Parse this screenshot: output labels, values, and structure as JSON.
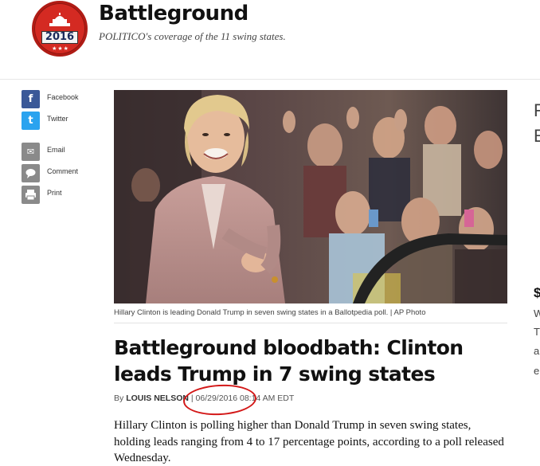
{
  "header": {
    "badge_year": "2016",
    "title": "Battleground",
    "subtitle": "POLITICO's coverage of the 11 swing states."
  },
  "share": {
    "items": [
      {
        "label": "Facebook",
        "icon": "facebook-icon",
        "glyph": "f",
        "color": "#3b5998"
      },
      {
        "label": "Twitter",
        "icon": "twitter-icon",
        "glyph": "t",
        "color": "#2aa3ef"
      },
      {
        "label": "Email",
        "icon": "email-icon",
        "glyph": "✉",
        "color": "#8a8a8a"
      },
      {
        "label": "Comment",
        "icon": "comment-icon",
        "glyph": "💬",
        "color": "#8a8a8a"
      },
      {
        "label": "Print",
        "icon": "print-icon",
        "glyph": "⎙",
        "color": "#8a8a8a"
      }
    ]
  },
  "article": {
    "photo_caption": "Hillary Clinton is leading Donald Trump in seven swing states in a Ballotpedia poll. | AP Photo",
    "headline": "Battleground bloodbath: Clinton leads Trump in 7 swing states",
    "byline_prefix": "By",
    "author": "Louis Nelson",
    "byline_sep": " | ",
    "date": "06/29/2016 08:14 AM EDT",
    "body": "Hillary Clinton is polling higher than Donald Trump in seven swing states, holding leads ranging from 4 to 17 percentage points, according to a poll released Wednesday."
  },
  "right_sliver": {
    "letters": [
      "F",
      "E",
      "$",
      "W",
      "T",
      "a",
      "e"
    ]
  },
  "colors": {
    "annotation_circle": "#d31818",
    "badge_red": "#d42a22"
  }
}
